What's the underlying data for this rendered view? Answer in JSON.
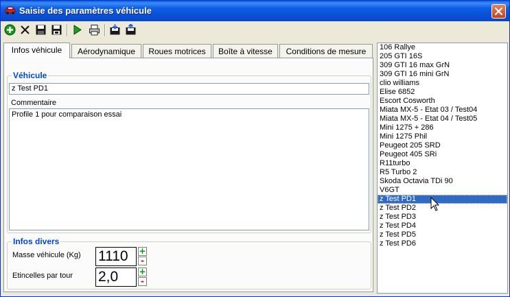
{
  "window": {
    "title": "Saisie des paramètres véhicule"
  },
  "toolbar": {
    "icons": [
      "add-icon",
      "delete-icon",
      "save-icon",
      "save-as-icon",
      "run-icon",
      "print-icon",
      "import-icon",
      "export-icon"
    ]
  },
  "tabs": [
    {
      "label": "Infos véhicule",
      "active": true
    },
    {
      "label": "Aérodynamique",
      "active": false
    },
    {
      "label": "Roues motrices",
      "active": false
    },
    {
      "label": "Boîte à vitesse",
      "active": false
    },
    {
      "label": "Conditions de mesure",
      "active": false
    }
  ],
  "vehicule_group": {
    "label": "Véhicule",
    "name_value": "z Test PD1",
    "comment_label": "Commentaire",
    "comment_value": "Profile 1 pour comparaison essai"
  },
  "infos_divers": {
    "label": "Infos divers",
    "masse_label": "Masse véhicule (Kg)",
    "masse_value": "1110",
    "etincelles_label": "Etincelles par tour",
    "etincelles_value": "2,0",
    "spin_up": "+",
    "spin_down": "-"
  },
  "vehicle_list": {
    "items": [
      "106 Rallye",
      "205 GTI 16S",
      "309 GTI 16 max GrN",
      "309 GTI 16 mini GrN",
      "clio williams",
      "Elise 6852",
      "Escort Cosworth",
      "Miata MX-5 - Etat 03 / Test04",
      "Miata MX-5 - Etat 04 / Test05",
      "Mini 1275 + 286",
      "Mini 1275 Phil",
      "Peugeot 205 SRD",
      "Peugeot 405 SRi",
      "R11turbo",
      "R5 Turbo 2",
      "Skoda Octavia TDi 90",
      "V6GT",
      "z Test PD1",
      "z Test PD2",
      "z Test PD3",
      "z Test PD4",
      "z Test PD5",
      "z Test PD6"
    ],
    "selected": "z Test PD1"
  },
  "colors": {
    "titlebar": "#0a4fd6",
    "selection": "#316ac5",
    "group_label": "#0046d5"
  }
}
